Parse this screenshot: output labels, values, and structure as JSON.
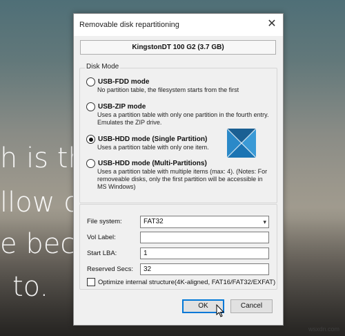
{
  "background": {
    "lines": [
      "h is th",
      "llow o",
      "e bec",
      "to."
    ]
  },
  "dialog": {
    "title": "Removable disk repartitioning",
    "device": "KingstonDT 100 G2 (3.7 GB)",
    "disk_mode": {
      "legend": "Disk Mode",
      "selected": "USB-HDD mode (Single Partition)",
      "options": [
        {
          "label": "USB-FDD mode",
          "desc": "No partition table, the filesystem starts from the first"
        },
        {
          "label": "USB-ZIP mode",
          "desc": "Uses a partition table with only one partition in the fourth entry. Emulates the ZIP drive."
        },
        {
          "label": "USB-HDD mode (Single Partition)",
          "desc": "Uses a partition table with only one item."
        },
        {
          "label": "USB-HDD mode (Multi-Partitions)",
          "desc": "Uses a partition table with multiple items (max: 4). (Notes: For removeable disks, only the first partition will be accessible in MS Windows)"
        }
      ]
    },
    "form": {
      "file_system_label": "File system:",
      "file_system_value": "FAT32",
      "vol_label_label": "Vol Label:",
      "vol_label_value": "",
      "start_lba_label": "Start LBA:",
      "start_lba_value": "1",
      "reserved_secs_label": "Reserved Secs:",
      "reserved_secs_value": "32",
      "optimize_label": "Optimize internal structure(4K-aligned, FAT16/FAT32/EXFAT)",
      "optimize_checked": false
    },
    "buttons": {
      "ok": "OK",
      "cancel": "Cancel"
    }
  },
  "watermark": "wsxdn.com",
  "colors": {
    "accent": "#0078d7",
    "window_bg": "#f0f0f0"
  }
}
